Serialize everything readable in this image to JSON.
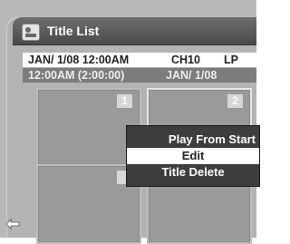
{
  "title_bar": {
    "icon": "title-list-icon",
    "title": "Title List"
  },
  "info": {
    "line1": {
      "date_time": "JAN/  1/08 12:00AM",
      "channel": "CH10",
      "mode": "LP"
    },
    "line2": {
      "time_length": "12:00AM (2:00:00)",
      "date": "JAN/  1/08"
    }
  },
  "tiles": [
    {
      "number": "1"
    },
    {
      "number": "2"
    },
    {
      "number": ""
    },
    {
      "number": ""
    }
  ],
  "context_menu": {
    "items": [
      "Play From Start",
      "Edit",
      "Title Delete"
    ],
    "selected": "Edit"
  },
  "nav": {
    "back_icon": "left-arrow-icon"
  }
}
